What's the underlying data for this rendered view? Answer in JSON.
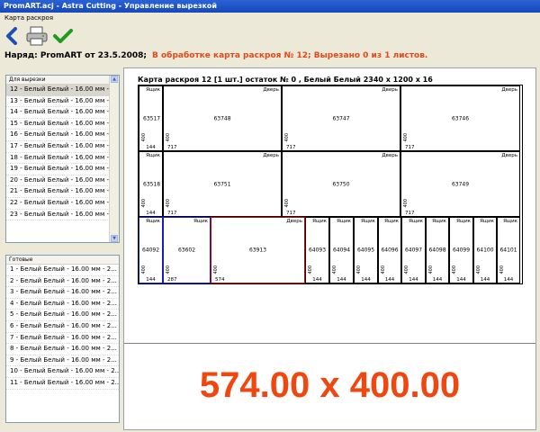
{
  "window": {
    "title": "PromART.acj - Astra Cutting - Управление вырезкой"
  },
  "menu": {
    "item": "Карта раскроя"
  },
  "toolbar": {
    "back_icon": "chevron-left-icon",
    "print_icon": "printer-icon",
    "ok_icon": "checkmark-icon"
  },
  "order": {
    "label": "Наряд: PromART от 23.5.2008;",
    "status": "В обработке карта раскроя № 12; Вырезано 0 из 1 листов."
  },
  "left": {
    "cut_header": "Для вырезки",
    "cut_items": [
      "12 - Белый Белый - 16.00 мм - 2...",
      "13 - Белый Белый - 16.00 мм - 2...",
      "14 - Белый Белый - 16.00 мм - 2...",
      "15 - Белый Белый - 16.00 мм - 2...",
      "16 - Белый Белый - 16.00 мм - 2...",
      "17 - Белый Белый - 16.00 мм - 2...",
      "18 - Белый Белый - 16.00 мм - 2...",
      "19 - Белый Белый - 16.00 мм - 2...",
      "20 - Белый Белый - 16.00 мм - 2...",
      "21 - Белый Белый - 16.00 мм - 2...",
      "22 - Белый Белый - 16.00 мм - 2...",
      "23 - Белый Белый - 16.00 мм - 2..."
    ],
    "done_header": "Готовые",
    "done_items": [
      "1 - Белый Белый - 16.00 мм - 2...",
      "2 - Белый Белый - 16.00 мм - 2...",
      "3 - Белый Белый - 16.00 мм - 2...",
      "4 - Белый Белый - 16.00 мм - 2...",
      "5 - Белый Белый - 16.00 мм - 2...",
      "6 - Белый Белый - 16.00 мм - 2...",
      "7 - Белый Белый - 16.00 мм - 2...",
      "8 - Белый Белый - 16.00 мм - 2...",
      "9 - Белый Белый - 16.00 мм - 2...",
      "10 - Белый Белый - 16.00 мм - 2...",
      "11 - Белый Белый - 16.00 мм - 2..."
    ]
  },
  "map": {
    "title": "Карта раскроя 12 [1 шт.] остаток № 0 , Белый Белый 2340 x 1200 x 16",
    "pieces": [
      {
        "id": "63517",
        "type": "Ящик",
        "w": "144",
        "h": "400"
      },
      {
        "id": "63748",
        "type": "Дверь",
        "w": "717",
        "h": "400"
      },
      {
        "id": "63747",
        "type": "Дверь",
        "w": "717",
        "h": "400"
      },
      {
        "id": "63746",
        "type": "Дверь",
        "w": "717",
        "h": "400"
      },
      {
        "id": "63518",
        "type": "Ящик",
        "w": "144",
        "h": "400"
      },
      {
        "id": "63751",
        "type": "Дверь",
        "w": "717",
        "h": "400"
      },
      {
        "id": "63750",
        "type": "Дверь",
        "w": "717",
        "h": "400"
      },
      {
        "id": "63749",
        "type": "Дверь",
        "w": "717",
        "h": "400"
      },
      {
        "id": "64092",
        "type": "Ящик",
        "w": "144",
        "h": "400"
      },
      {
        "id": "63602",
        "type": "Ящик",
        "w": "287",
        "h": "400"
      },
      {
        "id": "63913",
        "type": "Дверь",
        "w": "574",
        "h": "400"
      },
      {
        "id": "64093",
        "type": "Ящик",
        "w": "144",
        "h": "400"
      },
      {
        "id": "64094",
        "type": "Ящик",
        "w": "144",
        "h": "400"
      },
      {
        "id": "64095",
        "type": "Ящик",
        "w": "144",
        "h": "400"
      },
      {
        "id": "64096",
        "type": "Ящик",
        "w": "144",
        "h": "400"
      },
      {
        "id": "64097",
        "type": "Ящик",
        "w": "144",
        "h": "400"
      },
      {
        "id": "64098",
        "type": "Ящик",
        "w": "144",
        "h": "400"
      },
      {
        "id": "64099",
        "type": "Ящик",
        "w": "144",
        "h": "400"
      },
      {
        "id": "64100",
        "type": "Ящик",
        "w": "144",
        "h": "400"
      },
      {
        "id": "64101",
        "type": "Ящик",
        "w": "144",
        "h": "400"
      }
    ]
  },
  "selected_dims": "574.00 x 400.00",
  "colors": {
    "highlight_red": "#e04a1a",
    "selected_border": "#cc0000",
    "blue_border": "#1a1acc",
    "dims_color": "#f04610"
  }
}
